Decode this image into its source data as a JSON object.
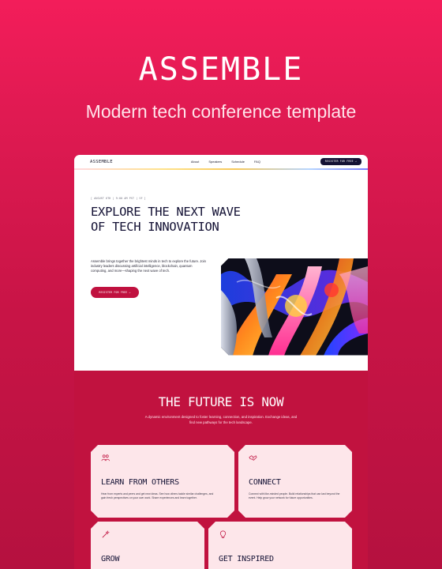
{
  "hero": {
    "logo": "ASSEMBLE",
    "subtitle": "Modern tech conference template"
  },
  "nav": {
    "logo": "ASSEMBLE",
    "links": [
      "About",
      "Speakers",
      "Schedule",
      "FAQ"
    ],
    "cta": "REGISTER FOR FREE →"
  },
  "main": {
    "tag": "[ AUGUST 6TH | 9:00 AM PST | SF ]",
    "headline_line1": "EXPLORE THE NEXT WAVE",
    "headline_line2": "OF TECH INNOVATION",
    "description": "Assemble brings together the brightest minds in tech to explore the future. Join industry leaders discussing artificial intelligence, blockchain, quantum computing, and more—shaping the next wave of tech.",
    "cta": "REGISTER FOR FREE →"
  },
  "future": {
    "title": "THE FUTURE IS NOW",
    "subtitle": "A dynamic environment designed to foster learning, connection, and inspiration. Exchange ideas, and find new pathways for the tech landscape."
  },
  "cards": [
    {
      "icon": "people-icon",
      "title": "LEARN FROM OTHERS",
      "description": "Hear from experts and peers and get new ideas. See how others tackle similar challenges, and gain fresh perspectives on your own work. Share experiences and learn together."
    },
    {
      "icon": "handshake-icon",
      "title": "CONNECT",
      "description": "Connect with like-minded people. Build relationships that can last beyond the event. Help grow your network for future opportunities."
    },
    {
      "icon": "sparkle-wand-icon",
      "title": "GROW",
      "description": ""
    },
    {
      "icon": "lightbulb-icon",
      "title": "GET INSPIRED",
      "description": ""
    }
  ],
  "colors": {
    "brand": "#e01a52",
    "navy": "#141235",
    "card": "#fde6ea"
  }
}
